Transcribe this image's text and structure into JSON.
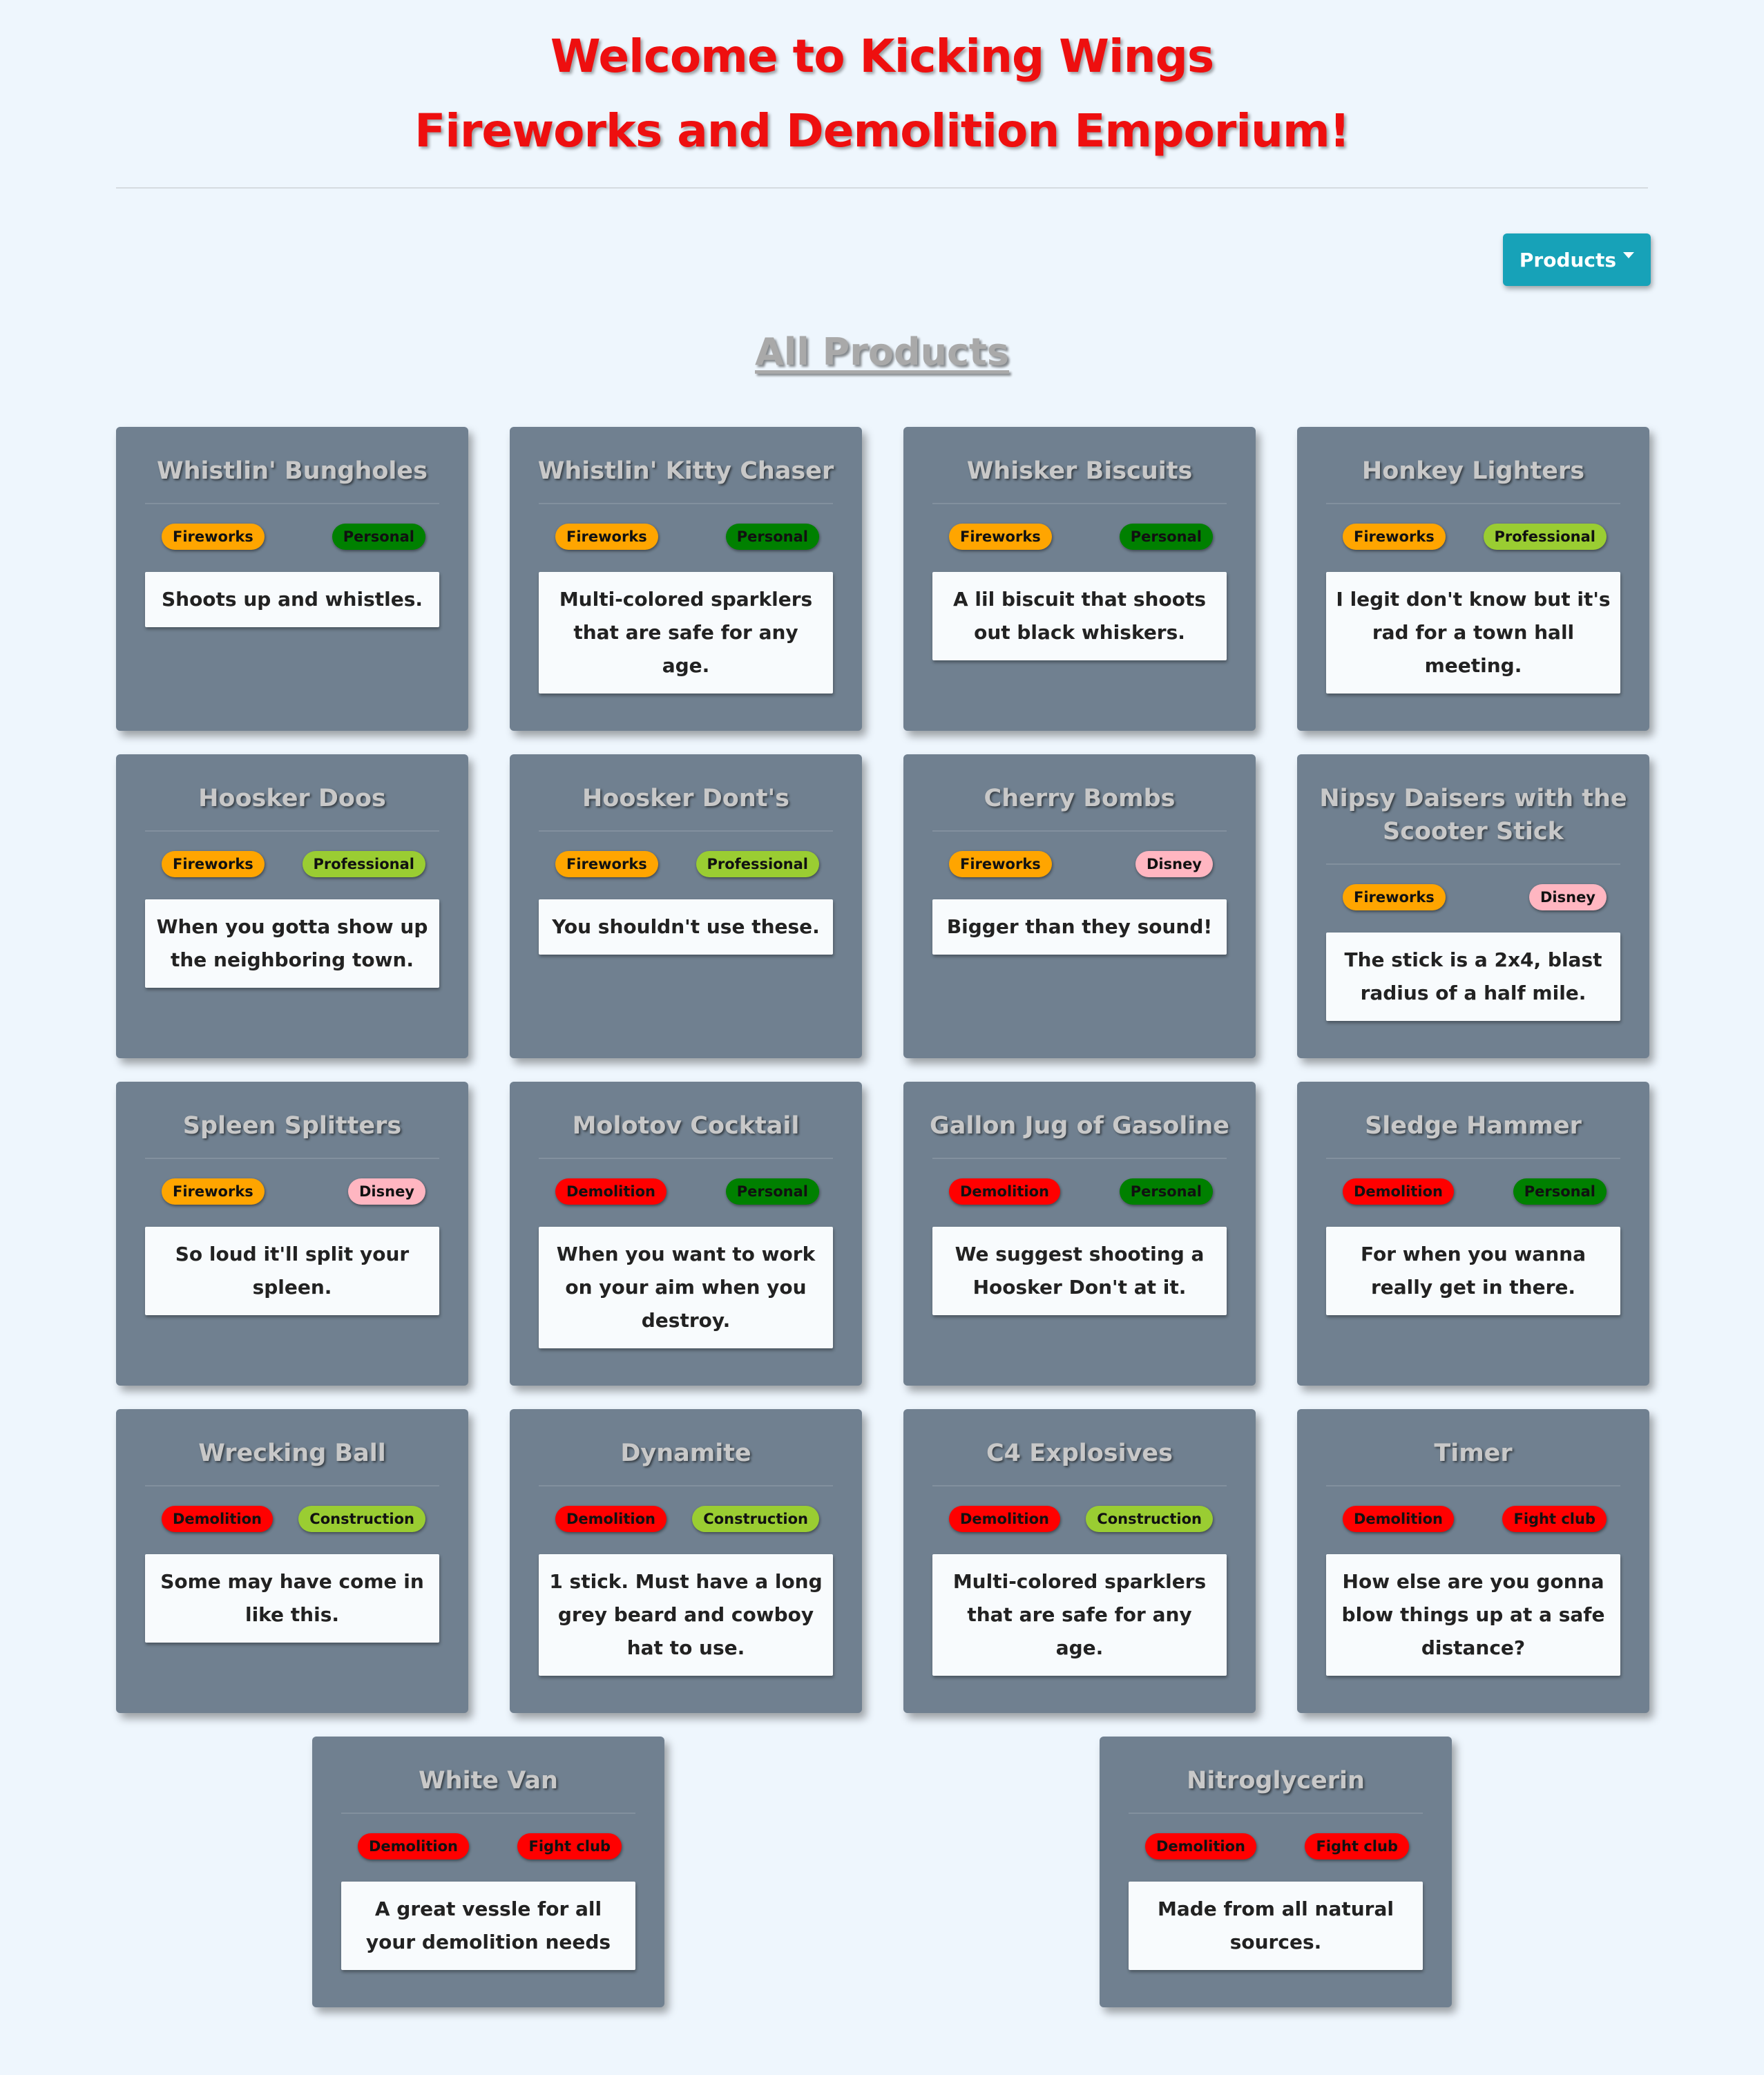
{
  "header": {
    "title_line1": "Welcome to Kicking Wings",
    "title_line2": "Fireworks and Demolition Emporium!"
  },
  "nav": {
    "products_label": "Products"
  },
  "section": {
    "title": "All Products"
  },
  "products": [
    {
      "name": "Whistlin' Bungholes",
      "category": "Fireworks",
      "tag": "Personal",
      "description": "Shoots up and whistles."
    },
    {
      "name": "Whistlin' Kitty Chaser",
      "category": "Fireworks",
      "tag": "Personal",
      "description": "Multi-colored sparklers that are safe for any age."
    },
    {
      "name": "Whisker Biscuits",
      "category": "Fireworks",
      "tag": "Personal",
      "description": "A lil biscuit that shoots out black whiskers."
    },
    {
      "name": "Honkey Lighters",
      "category": "Fireworks",
      "tag": "Professional",
      "description": "I legit don't know but it's rad for a town hall meeting."
    },
    {
      "name": "Hoosker Doos",
      "category": "Fireworks",
      "tag": "Professional",
      "description": "When you gotta show up the neighboring town."
    },
    {
      "name": "Hoosker Dont's",
      "category": "Fireworks",
      "tag": "Professional",
      "description": "You shouldn't use these."
    },
    {
      "name": "Cherry Bombs",
      "category": "Fireworks",
      "tag": "Disney",
      "description": "Bigger than they sound!"
    },
    {
      "name": "Nipsy Daisers with the Scooter Stick",
      "category": "Fireworks",
      "tag": "Disney",
      "description": "The stick is a 2x4, blast radius of a half mile."
    },
    {
      "name": "Spleen Splitters",
      "category": "Fireworks",
      "tag": "Disney",
      "description": "So loud it'll split your spleen."
    },
    {
      "name": "Molotov Cocktail",
      "category": "Demolition",
      "tag": "Personal",
      "description": "When you want to work on your aim when you destroy."
    },
    {
      "name": "Gallon Jug of Gasoline",
      "category": "Demolition",
      "tag": "Personal",
      "description": "We suggest shooting a Hoosker Don't at it."
    },
    {
      "name": "Sledge Hammer",
      "category": "Demolition",
      "tag": "Personal",
      "description": "For when you wanna really get in there."
    },
    {
      "name": "Wrecking Ball",
      "category": "Demolition",
      "tag": "Construction",
      "description": "Some may have come in like this."
    },
    {
      "name": "Dynamite",
      "category": "Demolition",
      "tag": "Construction",
      "description": "1 stick. Must have a long grey beard and cowboy hat to use."
    },
    {
      "name": "C4 Explosives",
      "category": "Demolition",
      "tag": "Construction",
      "description": "Multi-colored sparklers that are safe for any age."
    },
    {
      "name": "Timer",
      "category": "Demolition",
      "tag": "Fight club",
      "description": "How else are you gonna blow things up at a safe distance?"
    },
    {
      "name": "White Van",
      "category": "Demolition",
      "tag": "Fight club",
      "description": "A great vessle for all your demolition needs"
    },
    {
      "name": "Nitroglycerin",
      "category": "Demolition",
      "tag": "Fight club",
      "description": "Made from all natural sources."
    }
  ],
  "colors": {
    "page_background": "#eef6fd",
    "title_red": "#ee0f0f",
    "card_background": "#708090",
    "products_button": "#17a2b8",
    "fireworks": "#ffa500",
    "demolition": "#ff0000",
    "personal": "#008000",
    "professional": "#9acd32",
    "disney": "#ffb6c1",
    "construction": "#9acd32",
    "fight_club": "#ff0000"
  }
}
